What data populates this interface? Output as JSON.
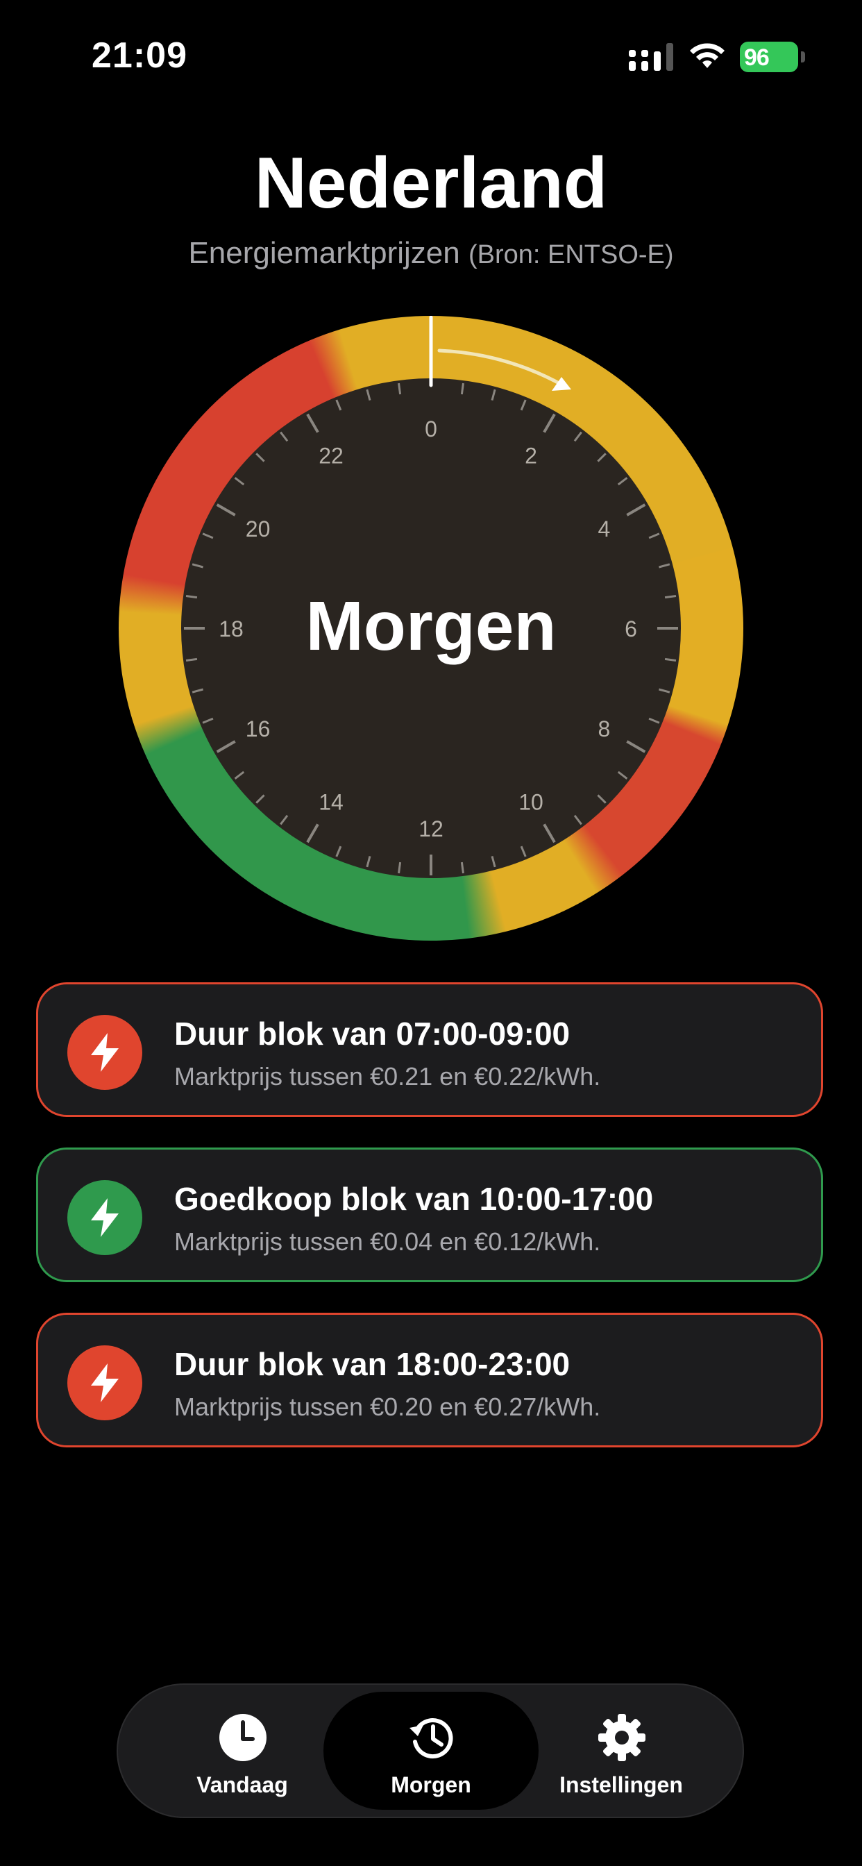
{
  "status_bar": {
    "time": "21:09",
    "battery": "96"
  },
  "header": {
    "title": "Nederland",
    "subtitle_main": "Energiemarktprijzen",
    "subtitle_source": "(Bron: ENTSO-E)"
  },
  "dial": {
    "center_label": "Morgen",
    "hour_labels": [
      "0",
      "2",
      "4",
      "6",
      "8",
      "10",
      "12",
      "14",
      "16",
      "18",
      "20",
      "22"
    ],
    "colors": {
      "expensive": "#d7472f",
      "medium": "#e1ae25",
      "cheap": "#31974b"
    }
  },
  "blocks": [
    {
      "title": "Duur blok van 07:00-09:00",
      "subtitle": "Marktprijs tussen €0.21 en €0.22/kWh.",
      "kind": "expensive"
    },
    {
      "title": "Goedkoop blok van 10:00-17:00",
      "subtitle": "Marktprijs tussen €0.04 en €0.12/kWh.",
      "kind": "cheap"
    },
    {
      "title": "Duur blok van 18:00-23:00",
      "subtitle": "Marktprijs tussen €0.20 en €0.27/kWh.",
      "kind": "expensive"
    }
  ],
  "tabbar": {
    "tabs": [
      {
        "label": "Vandaag",
        "icon": "clock-icon"
      },
      {
        "label": "Morgen",
        "icon": "history-icon"
      },
      {
        "label": "Instellingen",
        "icon": "gear-icon"
      }
    ],
    "active": "Morgen"
  }
}
